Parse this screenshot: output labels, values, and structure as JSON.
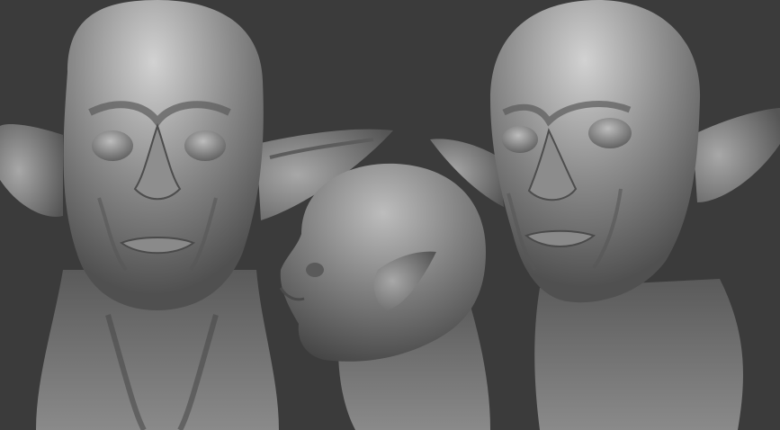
{
  "scene": {
    "background_color": "#3b3b3b",
    "clay_color": "#7b7b7b",
    "clay_highlight": "#c4c4c4",
    "clay_shadow": "#2f2f2f",
    "views": [
      {
        "view": "front"
      },
      {
        "view": "side-profile"
      },
      {
        "view": "three-quarter"
      }
    ]
  }
}
